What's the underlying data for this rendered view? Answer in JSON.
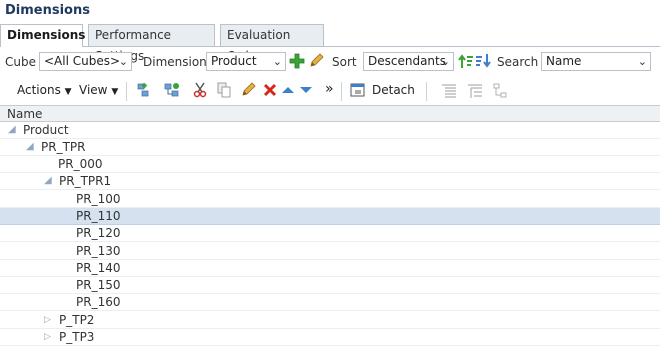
{
  "title": "Dimensions",
  "tabs": [
    {
      "label": "Dimensions"
    },
    {
      "label": "Performance Settings"
    },
    {
      "label": "Evaluation Order"
    }
  ],
  "selectors": {
    "cube_label": "Cube",
    "cube_value": "<All Cubes>",
    "dimension_label": "Dimension",
    "dimension_value": "Product",
    "sort_label": "Sort",
    "sort_value": "Descendants",
    "search_label": "Search",
    "search_value": "Name"
  },
  "toolbar": {
    "actions_label": "Actions",
    "view_label": "View",
    "overflow_label": "»",
    "detach_label": "Detach"
  },
  "grid": {
    "column_header": "Name",
    "rows": [
      {
        "label": "Product"
      },
      {
        "label": "PR_TPR"
      },
      {
        "label": "PR_000"
      },
      {
        "label": "PR_TPR1"
      },
      {
        "label": "PR_100"
      },
      {
        "label": "PR_110"
      },
      {
        "label": "PR_120"
      },
      {
        "label": "PR_130"
      },
      {
        "label": "PR_140"
      },
      {
        "label": "PR_150"
      },
      {
        "label": "PR_160"
      },
      {
        "label": "P_TP2"
      },
      {
        "label": "P_TP3"
      }
    ]
  },
  "colors": {
    "selected_row": "#d5e1ee",
    "title": "#1f3a60",
    "add_green": "#3aa335",
    "delete_red": "#d9261c",
    "move_blue": "#3d7fc8"
  }
}
